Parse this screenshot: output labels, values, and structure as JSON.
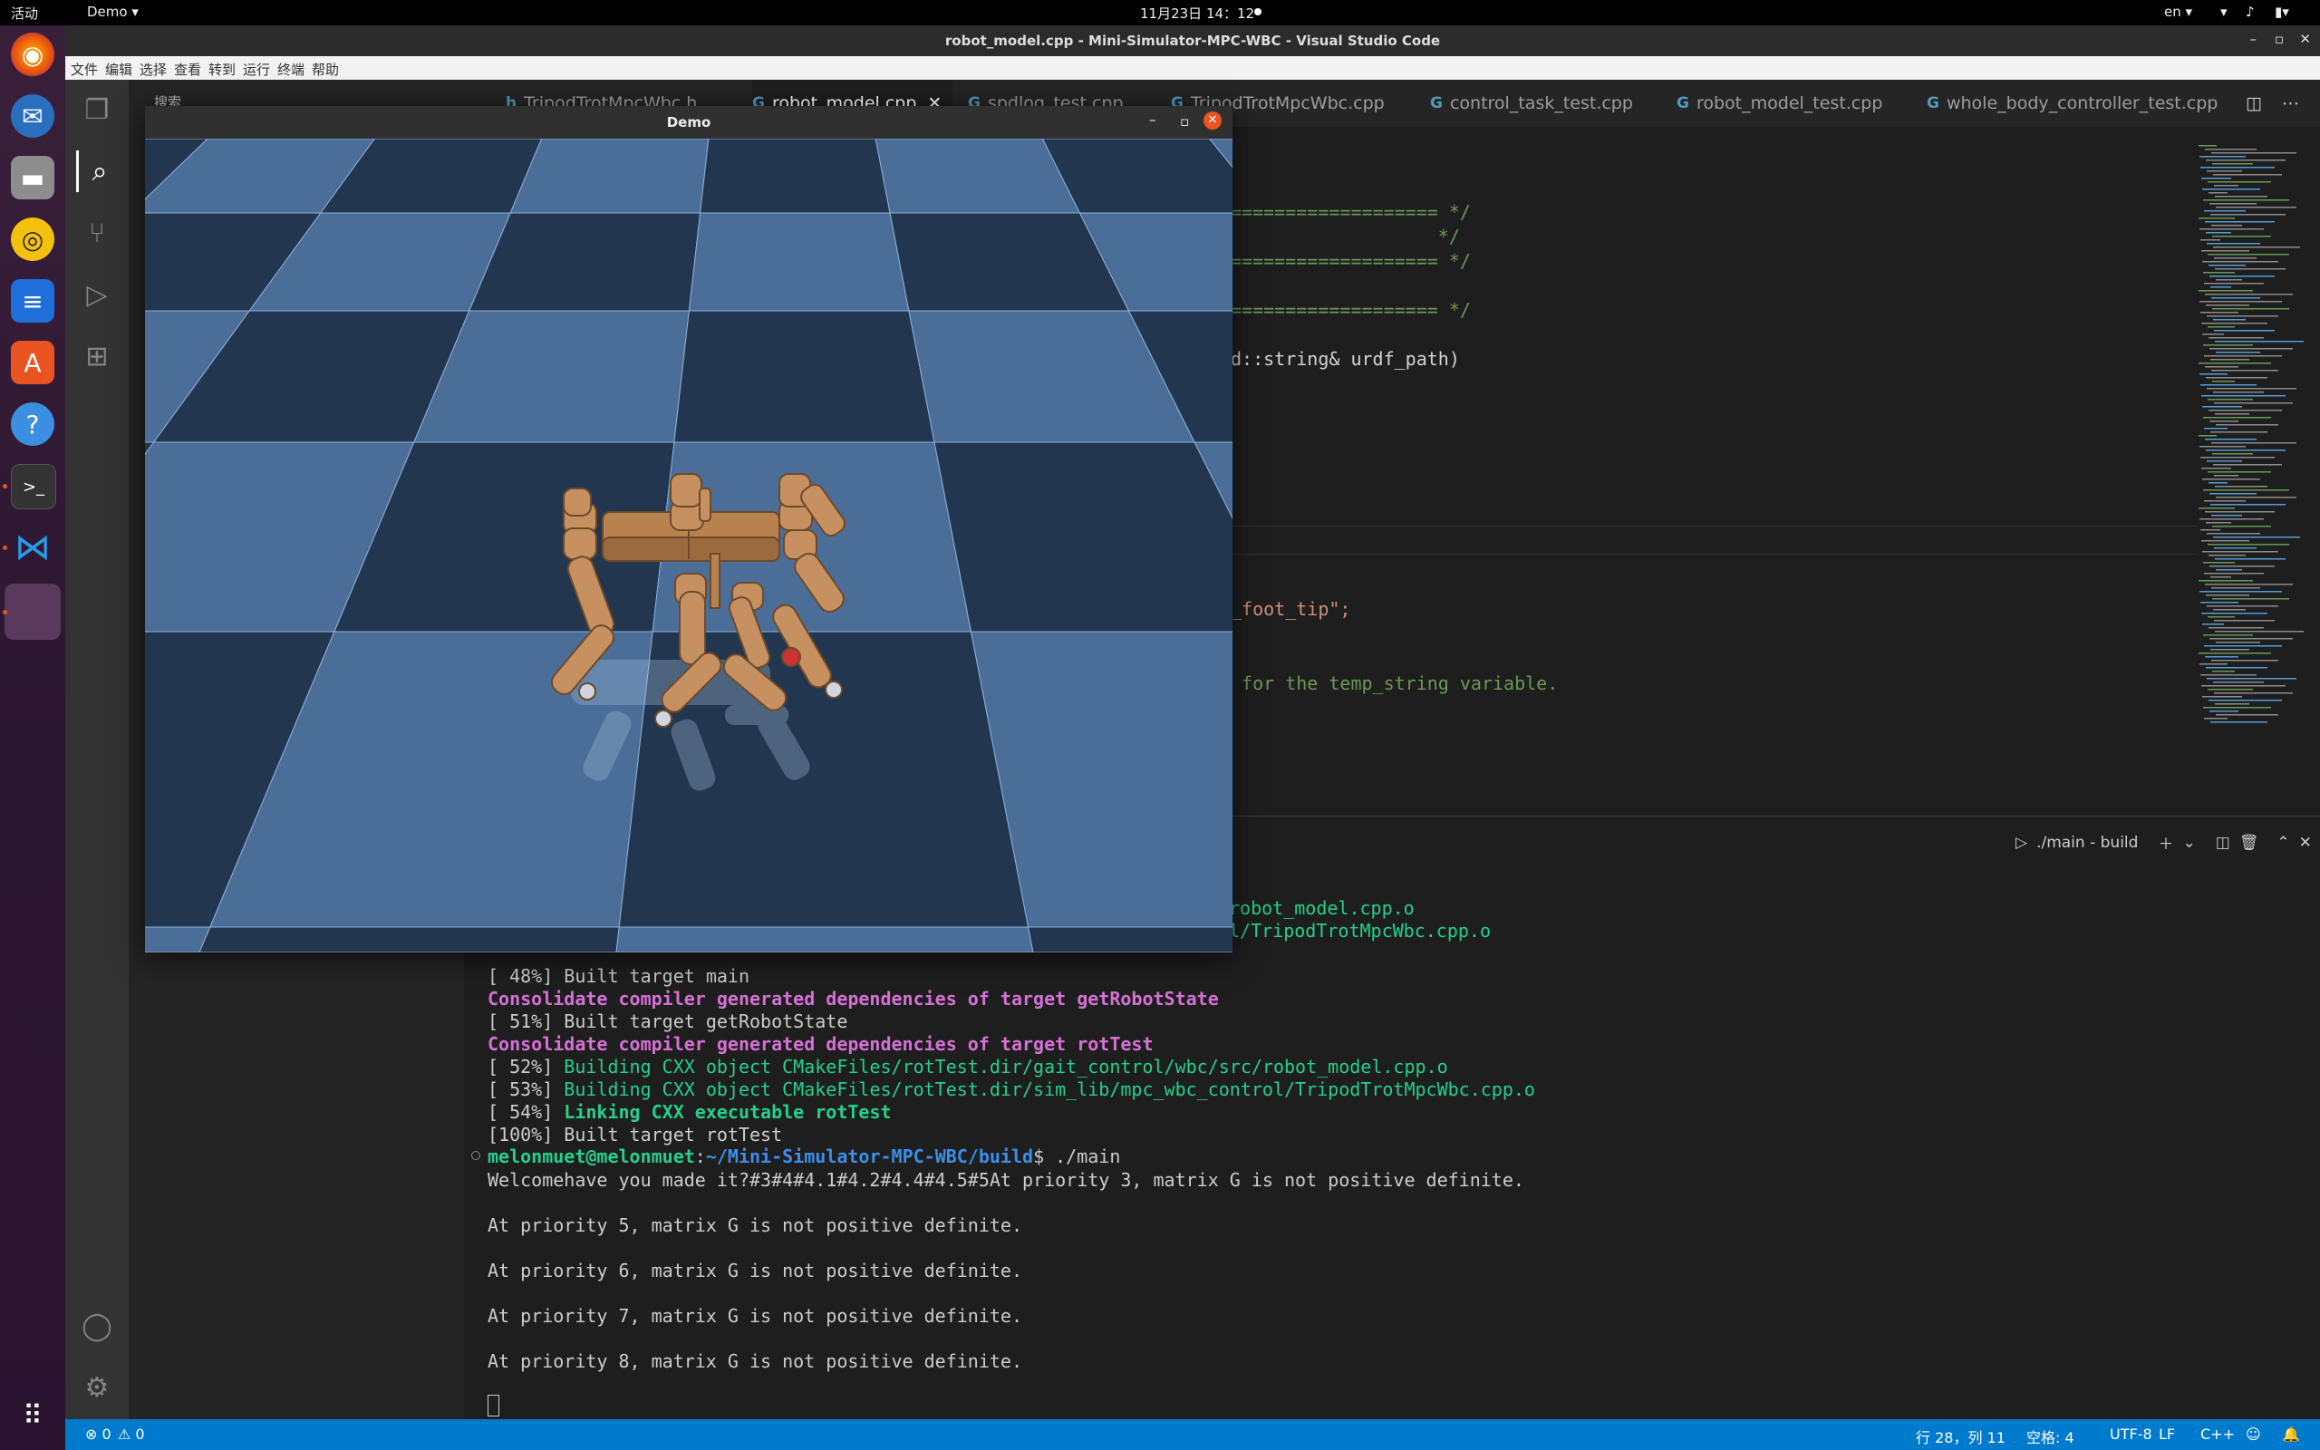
{
  "topbar": {
    "activities": "活动",
    "app_menu": "Demo ▾",
    "clock": "11月23日  14：12",
    "lang": "en ▾"
  },
  "dock": {
    "apps": [
      "firefox-icon",
      "thunderbird-icon",
      "files-icon",
      "rhythmbox-icon",
      "writer-icon",
      "app-center-icon",
      "help-icon",
      "terminal-icon",
      "vscode-icon",
      "demo-window-icon"
    ]
  },
  "vscode": {
    "window_title": "robot_model.cpp - Mini-Simulator-MPC-WBC - Visual Studio Code",
    "menu": [
      "文件",
      "编辑",
      "选择",
      "查看",
      "转到",
      "运行",
      "终端",
      "帮助"
    ],
    "sidebar_title": "搜索",
    "tabs": [
      {
        "label": "TripodTrotMpcWbc.h"
      },
      {
        "label": "robot_model.cpp"
      },
      {
        "label": "spdlog_test.cpp"
      },
      {
        "label": "TripodTrotMpcWbc.cpp"
      },
      {
        "label": "control_task_test.cpp"
      },
      {
        "label": "robot_model_test.cpp"
      },
      {
        "label": "whole_body_controller_test.cpp"
      }
    ],
    "code_lines": [
      "=================== */",
      "                   */",
      "=================== */",
      "=================== */",
      "d::string& urdf_path)",
      "_foot_tip\";",
      " for the temp_string variable."
    ],
    "terminal_header": "./main - build",
    "terminal_partial": [
      "robot_model.cpp.o",
      "l/TripodTrotMpcWbc.cpp.o"
    ],
    "terminal_lines": [
      {
        "pct": "[ 48%]",
        "text": " Built target main",
        "style": "plain"
      },
      {
        "pct": "",
        "text": "Consolidate compiler generated dependencies of target getRobotState",
        "style": "magenta"
      },
      {
        "pct": "[ 51%]",
        "text": " Built target getRobotState",
        "style": "plain"
      },
      {
        "pct": "",
        "text": "Consolidate compiler generated dependencies of target rotTest",
        "style": "magenta"
      },
      {
        "pct": "[ 52%]",
        "text": " Building CXX object CMakeFiles/rotTest.dir/gait_control/wbc/src/robot_model.cpp.o",
        "style": "green"
      },
      {
        "pct": "[ 53%]",
        "text": " Building CXX object CMakeFiles/rotTest.dir/sim_lib/mpc_wbc_control/TripodTrotMpcWbc.cpp.o",
        "style": "green"
      },
      {
        "pct": "[ 54%]",
        "text": " Linking CXX executable rotTest",
        "style": "boldgreen"
      },
      {
        "pct": "[100%]",
        "text": " Built target rotTest",
        "style": "plain"
      }
    ],
    "prompt_user": "melonmuet@melonmuet",
    "prompt_path": "~/Mini-Simulator-MPC-WBC/build",
    "prompt_cmd": "$ ./main",
    "output_lines": [
      "Welcomehave you made it?#3#4#4.1#4.2#4.4#4.5#5At priority 3, matrix G is not positive definite.",
      "",
      "At priority 5, matrix G is not positive definite.",
      "",
      "At priority 6, matrix G is not positive definite.",
      "",
      "At priority 7, matrix G is not positive definite.",
      "",
      "At priority 8, matrix G is not positive definite."
    ],
    "status": {
      "errors": "⊗ 0",
      "warnings": "⚠ 0",
      "position": "行 28，列 11",
      "spaces": "空格: 4",
      "encoding": "UTF-8",
      "eol": "LF",
      "language": "C++"
    }
  },
  "demo_window": {
    "title": "Demo"
  },
  "colors": {
    "dark_tile": "#23364f",
    "light_tile": "#4a6e98",
    "robot": "#b8824f"
  }
}
